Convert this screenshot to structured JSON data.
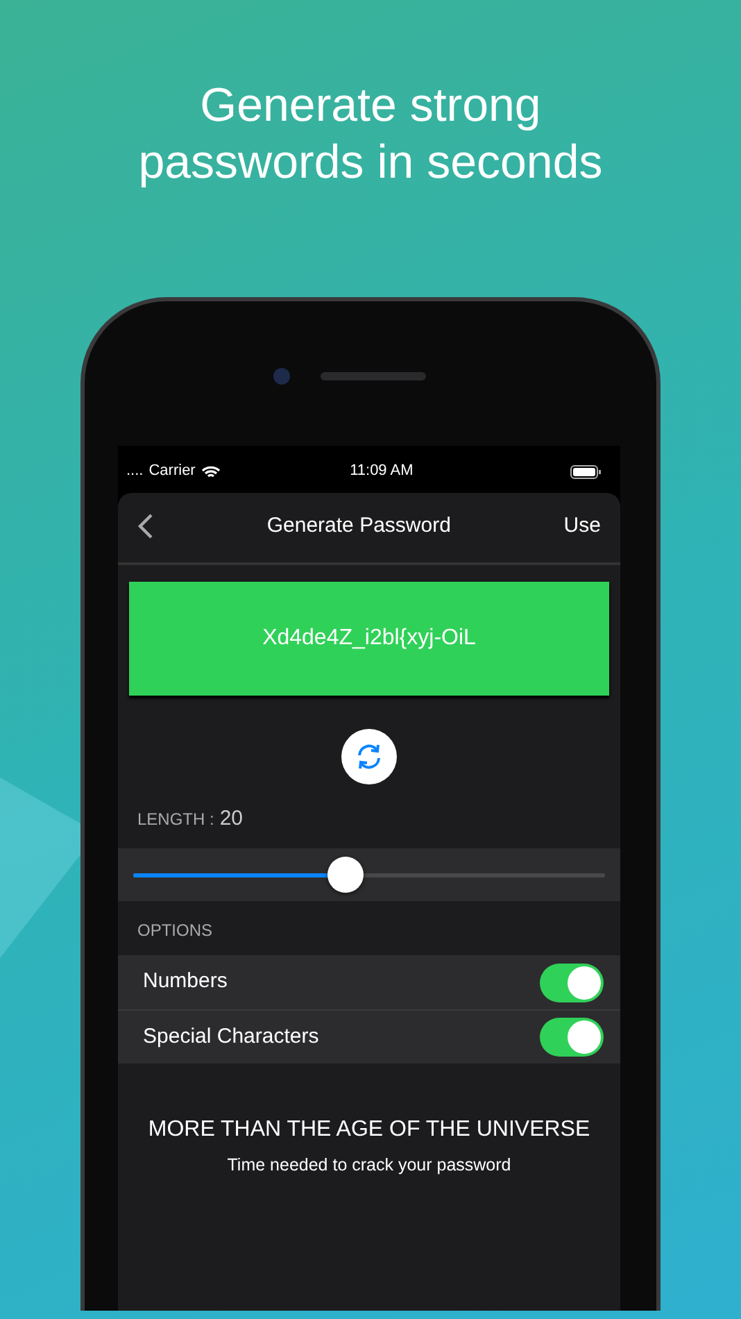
{
  "headline": "Generate strong passwords in seconds",
  "status_bar": {
    "signal": "....",
    "carrier": "Carrier",
    "time": "11:09 AM"
  },
  "nav": {
    "title": "Generate Password",
    "action": "Use"
  },
  "password": "Xd4de4Z_i2bl{xyj-OiL",
  "length": {
    "label": "LENGTH :",
    "value": "20",
    "level": 0.45
  },
  "options": {
    "header": "OPTIONS",
    "items": [
      {
        "label": "Numbers",
        "on": true
      },
      {
        "label": "Special Characters",
        "on": true
      }
    ]
  },
  "strength": {
    "title": "MORE THAN THE AGE OF THE UNIVERSE",
    "subtitle": "Time needed to crack your password"
  }
}
